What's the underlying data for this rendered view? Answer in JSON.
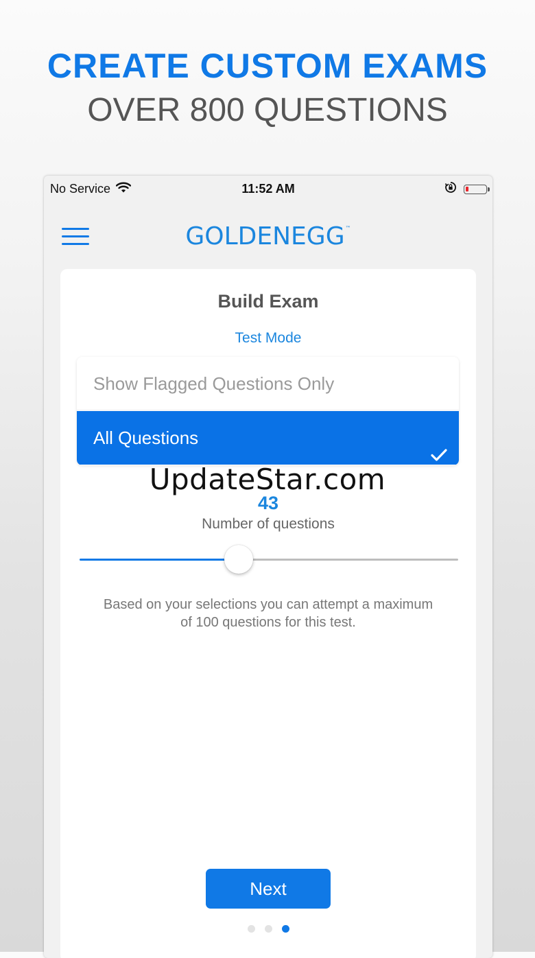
{
  "promo": {
    "title": "CREATE CUSTOM EXAMS",
    "subtitle": "OVER 800 QUESTIONS"
  },
  "status_bar": {
    "carrier": "No Service",
    "time": "11:52 AM",
    "icons": [
      "wifi-icon",
      "orientation-lock-icon",
      "battery-icon"
    ],
    "battery_color": "#e8262c"
  },
  "nav": {
    "menu_icon": "hamburger-menu-icon",
    "logo": "GOLDENEGG",
    "logo_mark": "™"
  },
  "build_exam": {
    "title": "Build Exam",
    "mode_link": "Test Mode",
    "options": [
      {
        "label": "Show Flagged Questions Only",
        "selected": false
      },
      {
        "label": "All Questions",
        "selected": true
      }
    ],
    "count": "43",
    "count_label": "Number of questions",
    "slider_value": 43,
    "slider_max": 100,
    "info": "Based on your selections you can attempt a maximum of 100 questions for this test.",
    "next_label": "Next"
  },
  "watermark": "UpdateStar.com",
  "pager": {
    "total": 3,
    "active": 3
  },
  "colors": {
    "accent": "#1079e6",
    "selected_row": "#0a72e6"
  }
}
